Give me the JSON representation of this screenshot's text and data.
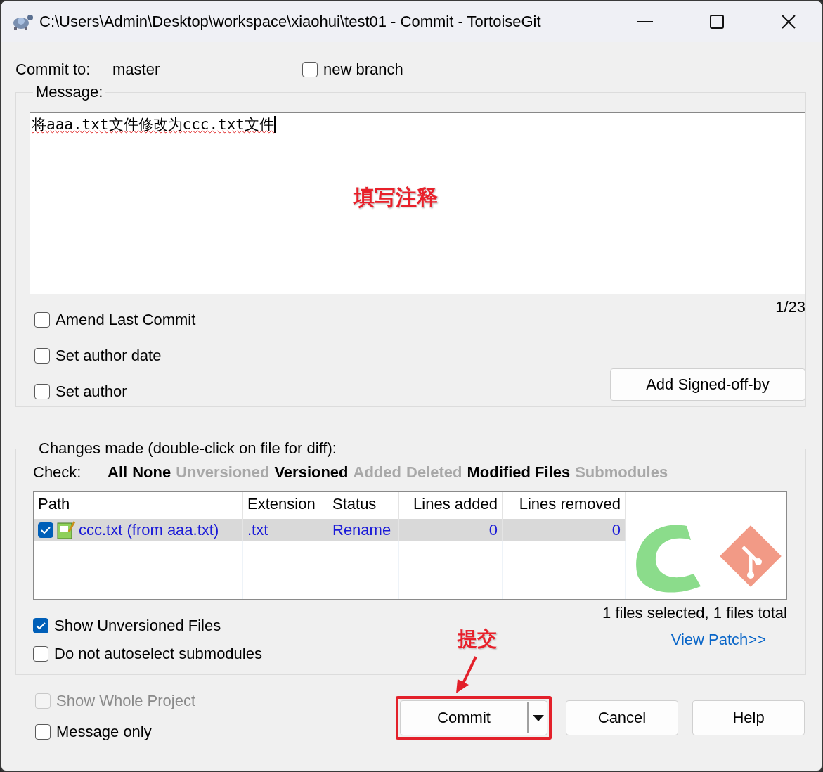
{
  "window": {
    "title": "C:\\Users\\Admin\\Desktop\\workspace\\xiaohui\\test01 - Commit - TortoiseGit"
  },
  "commit_to": {
    "label": "Commit to:",
    "branch": "master"
  },
  "new_branch": {
    "label": "new branch",
    "checked": false
  },
  "message": {
    "legend": "Message:",
    "text": "将aaa.txt文件修改为ccc.txt文件",
    "annotation": "填写注释",
    "counter": "1/23"
  },
  "options": [
    {
      "label": "Amend Last Commit",
      "checked": false
    },
    {
      "label": "Set author date",
      "checked": false
    },
    {
      "label": "Set author",
      "checked": false
    }
  ],
  "signoff_button": "Add Signed-off-by",
  "changes": {
    "legend": "Changes made (double-click on file for diff):",
    "check_label": "Check:",
    "filters": [
      {
        "label": "All",
        "enabled": true
      },
      {
        "label": "None",
        "enabled": true
      },
      {
        "label": "Unversioned",
        "enabled": false
      },
      {
        "label": "Versioned",
        "enabled": true
      },
      {
        "label": "Added",
        "enabled": false
      },
      {
        "label": "Deleted",
        "enabled": false
      },
      {
        "label": "Modified Files",
        "enabled": true
      },
      {
        "label": "Submodules",
        "enabled": false
      }
    ],
    "columns": [
      "Path",
      "Extension",
      "Status",
      "Lines added",
      "Lines removed"
    ],
    "rows": [
      {
        "checked": true,
        "selected": true,
        "path": "ccc.txt (from aaa.txt)",
        "extension": ".txt",
        "status": "Rename",
        "lines_added": "0",
        "lines_removed": "0"
      }
    ],
    "summary": "1 files selected, 1 files total",
    "toggles": [
      {
        "label": "Show Unversioned Files",
        "checked": true
      },
      {
        "label": "Do not autoselect submodules",
        "checked": false
      }
    ],
    "view_patch": "View Patch>>"
  },
  "footer_options": [
    {
      "label": "Show Whole Project",
      "checked": false,
      "disabled": true
    },
    {
      "label": "Message only",
      "checked": false,
      "disabled": false
    }
  ],
  "buttons": [
    {
      "kind": "split",
      "label": "Commit",
      "highlighted": true
    },
    {
      "kind": "plain",
      "label": "Cancel",
      "highlighted": false
    },
    {
      "kind": "plain",
      "label": "Help",
      "highlighted": false
    }
  ],
  "commit_annotation": "提交"
}
